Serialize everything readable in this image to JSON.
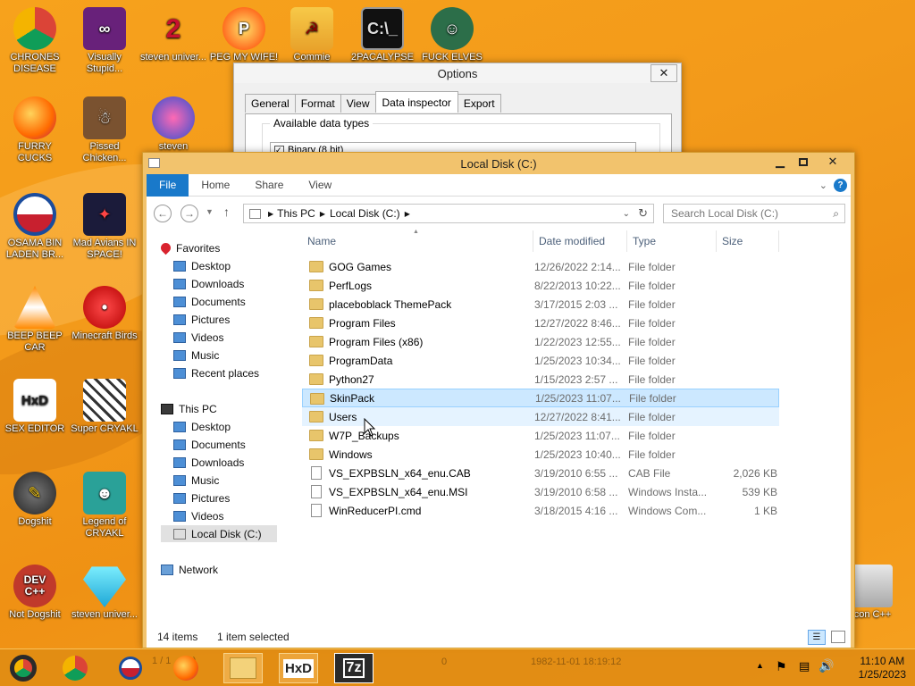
{
  "desktop_icons": [
    {
      "label": "CHRONES DISEASE",
      "icon": "chrome-icon"
    },
    {
      "label": "Visually Stupid...",
      "icon": "visual-studio-icon"
    },
    {
      "label": "steven univer...",
      "icon": "steven-universe-icon"
    },
    {
      "label": "PEG MY WIFE!",
      "icon": "peggle-icon"
    },
    {
      "label": "Commie",
      "icon": "commie-icon"
    },
    {
      "label": "2PACALYPSE",
      "icon": "cmd-icon"
    },
    {
      "label": "FUCK ELVES",
      "icon": "elf-icon"
    },
    {
      "label": "FURRY CUCKS",
      "icon": "firefox-icon"
    },
    {
      "label": "Pissed Chicken...",
      "icon": "angry-birds-seasons-icon"
    },
    {
      "label": "steven",
      "icon": "gem-icon"
    },
    {
      "label": "OSAMA BIN LADEN BR...",
      "icon": "obama-logo-icon"
    },
    {
      "label": "Mad Avians IN SPACE!",
      "icon": "angry-birds-space-icon"
    },
    {
      "label": "BEEP BEEP CAR",
      "icon": "vlc-icon"
    },
    {
      "label": "Minecraft Birds",
      "icon": "angry-bird-icon"
    },
    {
      "label": "SEX EDITOR",
      "icon": "hxd-icon"
    },
    {
      "label": "Super CRYAKL",
      "icon": "pixel-cat-icon"
    },
    {
      "label": "Dogshit",
      "icon": "dogshit-icon"
    },
    {
      "label": "Legend of CRYAKL",
      "icon": "pixel-character-icon"
    },
    {
      "label": "Not Dogshit",
      "icon": "dev-cpp-icon"
    },
    {
      "label": "steven univer...",
      "icon": "diamond-icon"
    },
    {
      "label": "Icon C++",
      "icon": "recycle-bin-icon"
    }
  ],
  "options_dialog": {
    "title": "Options",
    "tabs": [
      "General",
      "Format",
      "View",
      "Data inspector",
      "Export"
    ],
    "active_tab": "Data inspector",
    "group_label": "Available data types",
    "first_item": "Binary (8 bit)"
  },
  "explorer": {
    "title": "Local Disk (C:)",
    "ribbon_tabs": [
      "File",
      "Home",
      "Share",
      "View"
    ],
    "breadcrumb": [
      "This PC",
      "Local Disk (C:)"
    ],
    "search_placeholder": "Search Local Disk (C:)",
    "nav": {
      "favorites_label": "Favorites",
      "favorites": [
        "Desktop",
        "Downloads",
        "Documents",
        "Pictures",
        "Videos",
        "Music",
        "Recent places"
      ],
      "thispc_label": "This PC",
      "thispc": [
        "Desktop",
        "Documents",
        "Downloads",
        "Music",
        "Pictures",
        "Videos",
        "Local Disk (C:)"
      ],
      "network_label": "Network"
    },
    "columns": [
      "Name",
      "Date modified",
      "Type",
      "Size"
    ],
    "files": [
      {
        "name": "GOG Games",
        "date": "12/26/2022 2:14...",
        "type": "File folder",
        "size": "",
        "kind": "folder"
      },
      {
        "name": "PerfLogs",
        "date": "8/22/2013 10:22...",
        "type": "File folder",
        "size": "",
        "kind": "folder"
      },
      {
        "name": "placeboblack ThemePack",
        "date": "3/17/2015 2:03 ...",
        "type": "File folder",
        "size": "",
        "kind": "folder"
      },
      {
        "name": "Program Files",
        "date": "12/27/2022 8:46...",
        "type": "File folder",
        "size": "",
        "kind": "folder"
      },
      {
        "name": "Program Files (x86)",
        "date": "1/22/2023 12:55...",
        "type": "File folder",
        "size": "",
        "kind": "folder"
      },
      {
        "name": "ProgramData",
        "date": "1/25/2023 10:34...",
        "type": "File folder",
        "size": "",
        "kind": "folder"
      },
      {
        "name": "Python27",
        "date": "1/15/2023 2:57 ...",
        "type": "File folder",
        "size": "",
        "kind": "folder"
      },
      {
        "name": "SkinPack",
        "date": "1/25/2023 11:07...",
        "type": "File folder",
        "size": "",
        "kind": "folder"
      },
      {
        "name": "Users",
        "date": "12/27/2022 8:41...",
        "type": "File folder",
        "size": "",
        "kind": "folder"
      },
      {
        "name": "W7P_Backups",
        "date": "1/25/2023 11:07...",
        "type": "File folder",
        "size": "",
        "kind": "folder"
      },
      {
        "name": "Windows",
        "date": "1/25/2023 10:40...",
        "type": "File folder",
        "size": "",
        "kind": "folder"
      },
      {
        "name": "VS_EXPBSLN_x64_enu.CAB",
        "date": "3/19/2010 6:55 ...",
        "type": "CAB File",
        "size": "2,026 KB",
        "kind": "file"
      },
      {
        "name": "VS_EXPBSLN_x64_enu.MSI",
        "date": "3/19/2010 6:58 ...",
        "type": "Windows Insta...",
        "size": "539 KB",
        "kind": "file"
      },
      {
        "name": "WinReducerPI.cmd",
        "date": "3/18/2015 4:16 ...",
        "type": "Windows Com...",
        "size": "1 KB",
        "kind": "file"
      }
    ],
    "selected_row": "SkinPack",
    "hovered_row": "Users",
    "status_count": "14 items",
    "status_selected": "1 item selected"
  },
  "taskbar": {
    "time": "11:10 AM",
    "date": "1/25/2023",
    "background_text_1": "0",
    "background_text_2": "1982-11-01 18:19:12"
  },
  "colors": {
    "accent": "#1979ca",
    "title_bar": "#f2c36d",
    "desktop": "#f39a1a",
    "selection": "#cce8ff"
  }
}
